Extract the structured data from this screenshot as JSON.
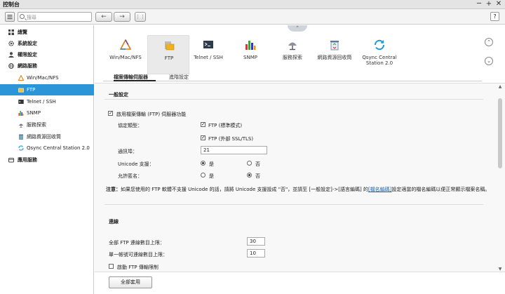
{
  "window": {
    "title": "控制台",
    "controls": [
      "─",
      "+",
      "✕"
    ]
  },
  "toolbar": {
    "search_placeholder": "搜尋",
    "back": "←",
    "forward": "→",
    "apps": "⋮⋮",
    "help": "?"
  },
  "sidebar": {
    "items": [
      {
        "label": "總覽"
      },
      {
        "label": "系統設定"
      },
      {
        "label": "權限設定"
      },
      {
        "label": "網路服務"
      },
      {
        "label": "Win/Mac/NFS"
      },
      {
        "label": "FTP"
      },
      {
        "label": "Telnet / SSH"
      },
      {
        "label": "SNMP"
      },
      {
        "label": "服務探索"
      },
      {
        "label": "網路資源回收筒"
      },
      {
        "label": "Qsync Central Station 2.0"
      },
      {
        "label": "應用服務"
      }
    ],
    "active_item": "FTP"
  },
  "main": {
    "collapse_label": "⌃",
    "tiles": [
      {
        "label": "Win/Mac/NFS"
      },
      {
        "label": "FTP"
      },
      {
        "label": "Telnet / SSH"
      },
      {
        "label": "SNMP"
      },
      {
        "label": "服務探索"
      },
      {
        "label": "網路資源回收筒"
      },
      {
        "label": "Qsync Central\nStation 2.0"
      }
    ],
    "selected_tile": "FTP",
    "nav_up": "⌃",
    "nav_down": "⌄",
    "subtabs": [
      {
        "label": "檔案傳輸伺服器"
      },
      {
        "label": "進階設定"
      }
    ]
  },
  "form": {
    "section_general": "一般設定",
    "enable_ftp": {
      "label": "啟用檔案傳輸 (FTP) 伺服器功能",
      "checked": true
    },
    "protocol_label": "協定類型：",
    "protocol_ftp": {
      "label": "FTP (標準模式)",
      "checked": true
    },
    "protocol_ftps": {
      "label": "FTP (外部 SSL/TLS)",
      "checked": true
    },
    "port_label": "通訊埠：",
    "port_value": "21",
    "unicode_label": "Unicode 支援：",
    "unicode_yes": "是",
    "unicode_no": "否",
    "unicode_selected": "是",
    "anon_label": "允許匿名：",
    "anon_yes": "是",
    "anon_no": "否",
    "anon_selected": "否",
    "note_prefix": "注意：",
    "note_text": "如果您使用的 FTP 軟體不支援 Unicode 的話，請將 Unicode 支援設成 \"否\"，並請至 [一般設定]->[語言編碼] 的",
    "note_link": "[檔名編碼]",
    "note_suffix": "設定適當的檔名編碼以便正常顯示檔案名稱。",
    "section_connection": "連線",
    "max_all_label": "全部 FTP 連線數目上限：",
    "max_all_value": "30",
    "max_single_label": "單一帳號可連線數目上限：",
    "max_single_value": "10",
    "limit_label": "啟動 FTP 傳輸限制",
    "limit_checked": false
  },
  "footer": {
    "apply_all": "全部套用"
  },
  "colors": {
    "accent": "#2b95d8",
    "link": "#1a63b5"
  }
}
